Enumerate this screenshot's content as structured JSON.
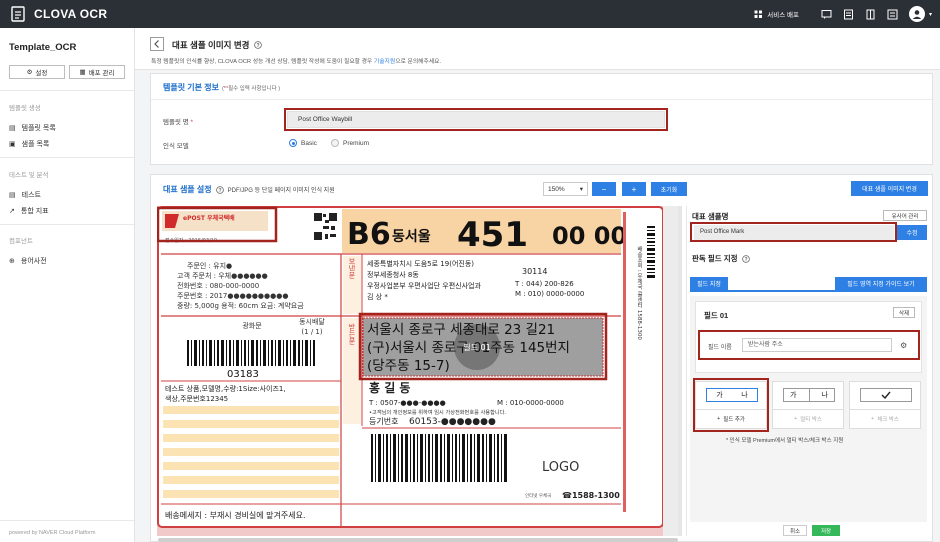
{
  "app": {
    "brand": "CLOVA OCR",
    "deploy_label": "서비스 배포"
  },
  "sidebar": {
    "title": "Template_OCR",
    "settings_label": "설정",
    "deploy_mgmt_label": "배포 관리",
    "sections": [
      {
        "label": "템플릿 생성",
        "items": [
          "템플릿 목록",
          "샘플 목록"
        ]
      },
      {
        "label": "테스트 및 분석",
        "items": [
          "테스트",
          "통합 지표"
        ]
      },
      {
        "label": "컴포넌트",
        "items": [
          "용어사전"
        ]
      }
    ],
    "footer": "powered by NAVER Cloud Platform"
  },
  "header": {
    "title": "대표 샘플 이미지 변경",
    "subtitle_pre": "특정 템플릿의 인식률 향상, CLOVA OCR 성능 개선 상담, 템플릿 작성에 도움이 필요할 경우 ",
    "subtitle_link": "기술지원",
    "subtitle_post": "으로 문의해주세요."
  },
  "template_info": {
    "title": "템플릿 기본 정보",
    "required_note_star": "(*",
    "required_note": "필수 입력 사항입니다 )",
    "name_label": "템플릿 명",
    "name_value": "Post Office Waybill",
    "model_label": "인식 모델",
    "model_options": [
      "Basic",
      "Premium"
    ]
  },
  "sample": {
    "title": "대표 샘플 설정",
    "note": "PDF/JPG 등 단일 페이지 이미지 인식 지원",
    "zoom": "150%",
    "zoom_out": "−",
    "zoom_in": "+",
    "reset": "초기화",
    "change_image": "대표 샘플 이미지 변경"
  },
  "waybill": {
    "date": "접수일자 : 2016/03/10",
    "code": "B6",
    "region": "동서울",
    "num_a": "451",
    "num_b": "00 00",
    "sender_lines": [
      "주문인 : 유지●",
      "고객 주문처 : 우체●●●●●●",
      "전화번호 : 080-000-0000",
      "주문번호 : 2017●●●●●●●●●●",
      "중량: 5,000g  용적: 60cm  요금: 계약요금"
    ],
    "sender_addr": [
      "세종특별자치시 도움5로 19(어진동)",
      "정부세종청사 8동",
      "우정사업본부 우편사업단 우편신사업과",
      "김 상 *"
    ],
    "zip_sender": "30114",
    "tel_sender": "T : 044) 200-826",
    "mob_sender": "M : 010) 0000-0000",
    "side_sender": "보낸분",
    "side_receiver": "받는분",
    "office": "광화문",
    "delivery": "동시배달",
    "delivery_count": "(1 / 1)",
    "zip": "03183",
    "items_text": "테스트 상품,모델명,수량:1Size:사이즈1,",
    "items_text2": "색상,주문번호12345",
    "recv_addr": [
      "서울시 종로구 세종대로 23 길21",
      "(구)서울시 종로구 01주동 145번지",
      "(당주동 15-7)"
    ],
    "recv_name": "홍 길 동",
    "recv_tel": "T : 0507-●●●-●●●●",
    "recv_mob": "M : 010-0000-0000",
    "recv_note": "•고객님의 개인정보를 위하여 임시 가상전화번호를 사용합니다.",
    "reg_label": "등기번호",
    "reg_no": "60153-●●●●●●●",
    "logo": "LOGO",
    "callcenter": "☎1588-1300",
    "callcenter_label": "인터넷 우체국",
    "message": "배송메세지 : 부재시 경비실에 맡겨주세요.",
    "overlay": "필드 01",
    "side_vertical": "배송조회 : 우체국 콜센터 1588-1300",
    "post_logo": "ePOST 우체국택배"
  },
  "panel": {
    "sample_name_label": "대표 샘플명",
    "user_mgr": "유사어 관리",
    "sample_name": "Post Office Mark",
    "edit": "수정",
    "field_setting_label": "판독 필드 지정",
    "tab_field": "필드 지정",
    "tab_guide": "필드 영역 지정 가이드 보기",
    "field_title": "필드 01",
    "delete": "삭제",
    "field_name_label": "필드 이름",
    "field_name_value": "받는사람 주소",
    "opt1": [
      "가",
      "나"
    ],
    "opt2": [
      "가",
      "나"
    ],
    "add_field": "필드 추가",
    "multi_box": "멀티 박스",
    "check_box": "체크 박스",
    "note": "* 인식 모델 Premium에서 멀티 박스/체크 박스 지원",
    "cancel": "취소",
    "save": "저장"
  },
  "colors": {
    "accent": "#2f80e4",
    "topbar": "#2b2f36",
    "highlight": "#a3241d",
    "save": "#35b85a"
  }
}
